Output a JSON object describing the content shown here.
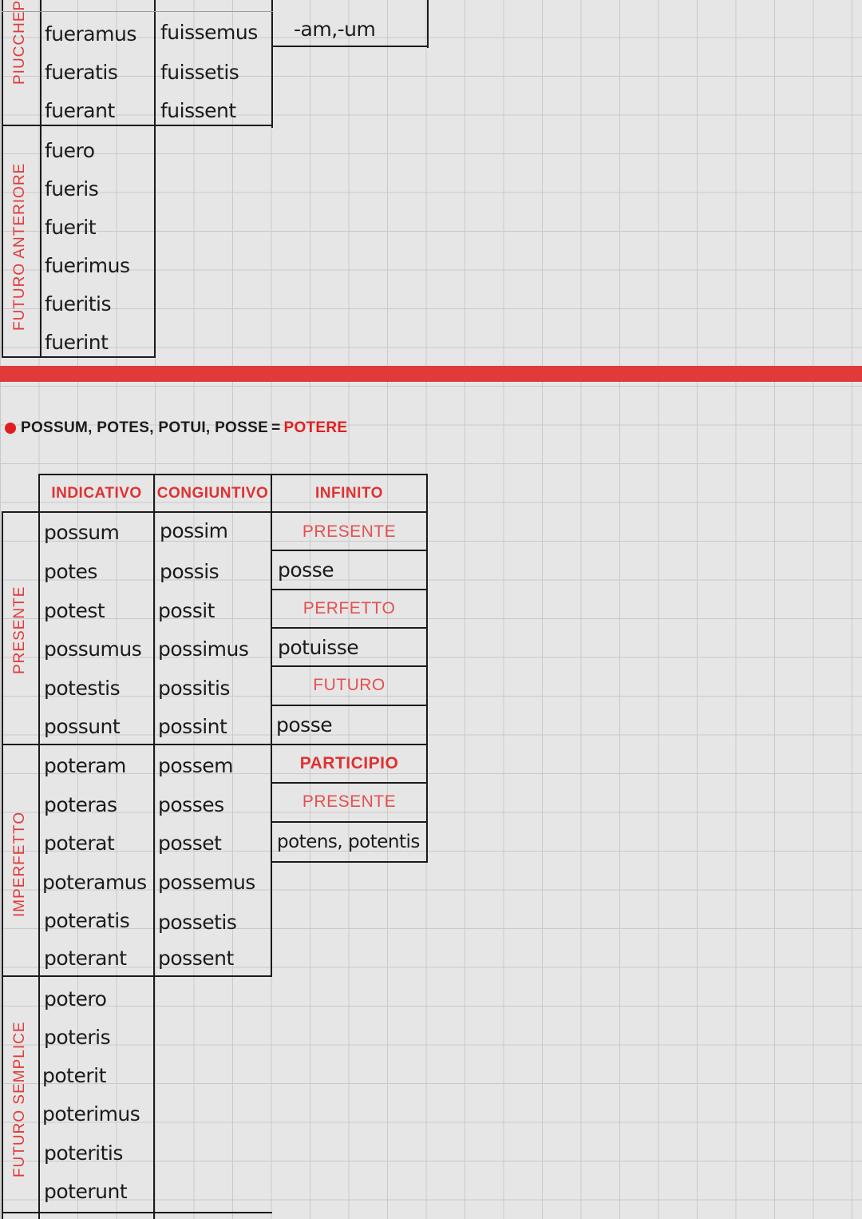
{
  "top_table": {
    "pluperfect_side_label": "PIUCCHEP",
    "future_perfect_side_label": "FUTURO ANTERIORE",
    "pluperfect_indicative": [
      "fueramus",
      "fueratis",
      "fuerant"
    ],
    "pluperfect_subjunctive": [
      "fuissemus",
      "fuissetis",
      "fuissent"
    ],
    "participle_ending": "-am,-um",
    "future_perfect_indicative": [
      "fuero",
      "fueris",
      "fuerit",
      "fuerimus",
      "fueritis",
      "fuerint"
    ]
  },
  "divider_color": "#e03a3a",
  "verb_heading": {
    "forms": "POSSUM, POTES, POTUI, POSSE",
    "equals": "=",
    "meaning": "POTERE"
  },
  "potere_table": {
    "headers": {
      "indicative": "INDICATIVO",
      "subjunctive": "CONGIUNTIVO",
      "infinitive": "INFINITO"
    },
    "side_labels": {
      "present": "PRESENTE",
      "imperfect": "IMPERFETTO",
      "future": "FUTURO SEMPLICE"
    },
    "present_indicative": [
      "possum",
      "potes",
      "potest",
      "possumus",
      "potestis",
      "possunt"
    ],
    "present_subjunctive": [
      "possim",
      "possis",
      "possit",
      "possimus",
      "possitis",
      "possint"
    ],
    "imperfect_indicative": [
      "poteram",
      "poteras",
      "poterat",
      "poteramus",
      "poteratis",
      "poterant"
    ],
    "imperfect_subjunctive": [
      "possem",
      "posses",
      "posset",
      "possemus",
      "possetis",
      "possent"
    ],
    "future_indicative": [
      "potero",
      "poteris",
      "poterit",
      "poterimus",
      "poteritis",
      "poterunt"
    ],
    "infinitive_column": {
      "present_label": "PRESENTE",
      "present_value": "posse",
      "perfect_label": "PERFETTO",
      "perfect_value": "potuisse",
      "future_label": "FUTURO",
      "future_value": "posse",
      "participle_label": "PARTICIPIO",
      "participle_present_label": "PRESENTE",
      "participle_value": "potens, potentis"
    }
  }
}
